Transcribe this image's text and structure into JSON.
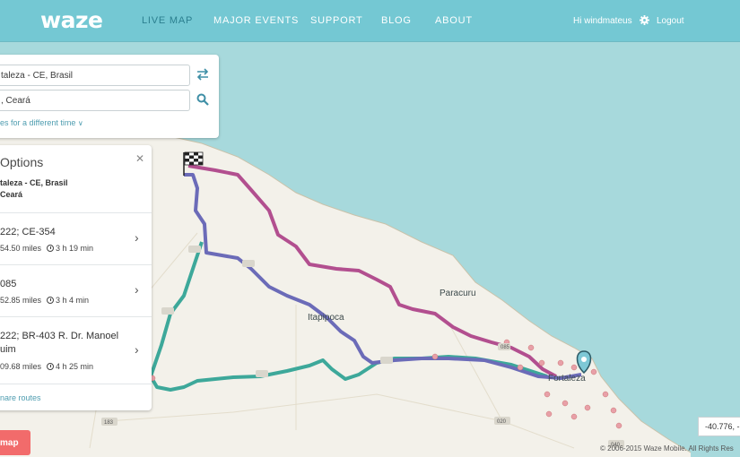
{
  "header": {
    "logo": "waze",
    "nav": [
      {
        "label": "LIVE MAP",
        "active": true
      },
      {
        "label": "MAJOR EVENTS",
        "active": false
      },
      {
        "label": "SUPPORT",
        "active": false
      },
      {
        "label": "BLOG",
        "active": false
      },
      {
        "label": "ABOUT",
        "active": false
      }
    ],
    "greeting": "Hi windmateus",
    "logout": "Logout"
  },
  "search": {
    "from": "taleza - CE, Brasil",
    "to": ", Ceará",
    "leave_later": "es for a different time",
    "icons": {
      "swap": "swap-arrows-icon",
      "search": "search-icon"
    }
  },
  "routes": {
    "title": "Options",
    "from": "taleza - CE, Brasil",
    "to": "Ceará",
    "items": [
      {
        "name": "222; CE-354",
        "miles": "54.50 miles",
        "time": "3 h 19 min"
      },
      {
        "name": "085",
        "miles": "52.85 miles",
        "time": "3 h 4 min"
      },
      {
        "name": "222; BR-403 R. Dr. Manoel",
        "name2": "uim",
        "miles": "09.68 miles",
        "time": "4 h 25 min"
      }
    ],
    "more": "nare routes"
  },
  "map": {
    "labels": [
      "Paracuru",
      "Itapipoca",
      "Fortaleza"
    ],
    "shields": [
      "085",
      "020",
      "183",
      "040"
    ],
    "colors": {
      "water": "#a7d9dc",
      "land": "#f3f1ea",
      "route_main": "#6b6bb8",
      "route_alt1": "#b24f8f",
      "route_alt2": "#3da89a",
      "header": "#74c8d3"
    }
  },
  "bottom": {
    "map_button": "map",
    "coords": "-40.776, -",
    "copyright": "© 2006-2015 Waze Mobile. All Rights Res"
  }
}
